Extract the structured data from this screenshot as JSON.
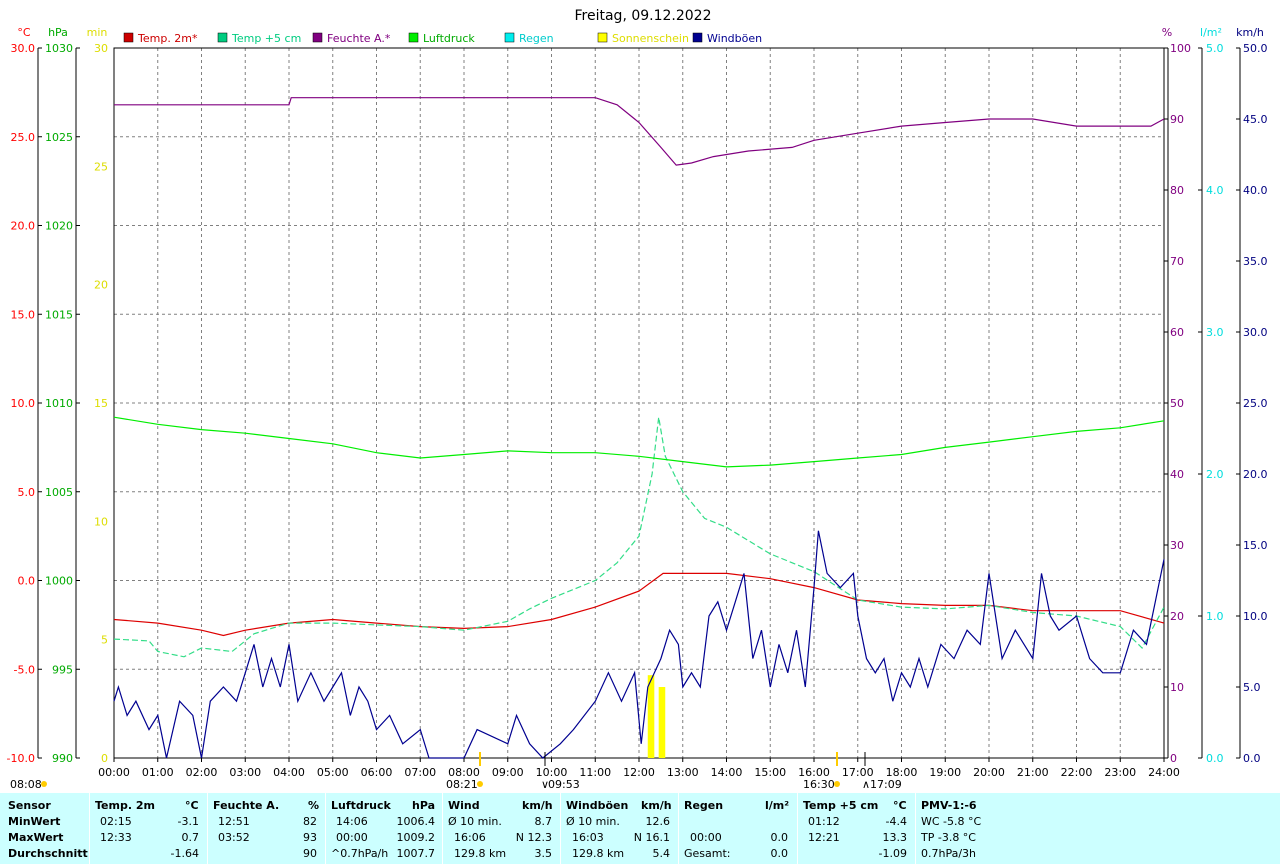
{
  "chart_data": {
    "type": "line",
    "title": "Freitag, 09.12.2022",
    "x_ticks": [
      "00:00",
      "01:00",
      "02:00",
      "03:00",
      "04:00",
      "05:00",
      "06:00",
      "07:00",
      "08:00",
      "09:00",
      "10:00",
      "11:00",
      "12:00",
      "13:00",
      "14:00",
      "15:00",
      "16:00",
      "17:00",
      "18:00",
      "19:00",
      "20:00",
      "21:00",
      "22:00",
      "23:00",
      "24:00"
    ],
    "axes": {
      "temp": {
        "unit": "°C",
        "range": [
          -10,
          30
        ],
        "ticks": [
          "30.0",
          "25.0",
          "20.0",
          "15.0",
          "10.0",
          "5.0",
          "0.0",
          "-5.0",
          "-10.0"
        ],
        "color": "#ff0000"
      },
      "pressure": {
        "unit": "hPa",
        "range": [
          990,
          1030
        ],
        "ticks": [
          "1030",
          "1025",
          "1020",
          "1015",
          "1010",
          "1005",
          "1000",
          "995",
          "990"
        ],
        "color": "#00aa00"
      },
      "sunshine": {
        "unit": "min",
        "range": [
          0,
          30
        ],
        "ticks": [
          "30",
          "25",
          "20",
          "15",
          "10",
          "5",
          "0"
        ],
        "color": "#dddd00"
      },
      "humidity": {
        "unit": "%",
        "range": [
          0,
          100
        ],
        "ticks": [
          "100",
          "90",
          "80",
          "70",
          "60",
          "50",
          "40",
          "30",
          "20",
          "10",
          "0"
        ],
        "color": "#800080"
      },
      "rain": {
        "unit": "l/m²",
        "range": [
          0,
          5
        ],
        "ticks": [
          "5.0",
          "4.0",
          "3.0",
          "2.0",
          "1.0",
          "0.0"
        ],
        "color": "#00dddd"
      },
      "wind": {
        "unit": "km/h",
        "range": [
          0,
          50
        ],
        "ticks": [
          "50.0",
          "45.0",
          "40.0",
          "35.0",
          "30.0",
          "25.0",
          "20.0",
          "15.0",
          "10.0",
          "5.0",
          "0.0"
        ],
        "color": "#000080"
      }
    },
    "legend": [
      {
        "name": "Temp. 2m*",
        "color": "#cc0000"
      },
      {
        "name": "Temp +5 cm",
        "color": "#00cc80"
      },
      {
        "name": "Feuchte A.*",
        "color": "#800080"
      },
      {
        "name": "Luftdruck",
        "color": "#00ee00"
      },
      {
        "name": "Regen",
        "color": "#00eeee"
      },
      {
        "name": "Sonnenschein",
        "color": "#ffff00"
      },
      {
        "name": "Windböen",
        "color": "#000090"
      }
    ],
    "series": [
      {
        "name": "Temp. 2m*",
        "axis": "temp",
        "color": "#dd0000",
        "points": [
          [
            0,
            -2.2
          ],
          [
            1,
            -2.4
          ],
          [
            2,
            -2.8
          ],
          [
            2.5,
            -3.1
          ],
          [
            3,
            -2.8
          ],
          [
            4,
            -2.4
          ],
          [
            5,
            -2.2
          ],
          [
            6,
            -2.4
          ],
          [
            7,
            -2.6
          ],
          [
            8,
            -2.7
          ],
          [
            9,
            -2.6
          ],
          [
            10,
            -2.2
          ],
          [
            11,
            -1.5
          ],
          [
            12,
            -0.6
          ],
          [
            12.55,
            0.4
          ],
          [
            13,
            0.4
          ],
          [
            14,
            0.4
          ],
          [
            15,
            0.1
          ],
          [
            16,
            -0.4
          ],
          [
            17,
            -1.1
          ],
          [
            18,
            -1.3
          ],
          [
            19,
            -1.4
          ],
          [
            20,
            -1.4
          ],
          [
            21,
            -1.7
          ],
          [
            22,
            -1.7
          ],
          [
            23,
            -1.7
          ],
          [
            24,
            -2.4
          ]
        ]
      },
      {
        "name": "Temp +5 cm",
        "axis": "temp",
        "color": "#33dd88",
        "points": [
          [
            0,
            -3.3
          ],
          [
            0.8,
            -3.4
          ],
          [
            1,
            -4.0
          ],
          [
            1.6,
            -4.3
          ],
          [
            2,
            -3.8
          ],
          [
            2.7,
            -4.0
          ],
          [
            3.2,
            -3.0
          ],
          [
            4,
            -2.4
          ],
          [
            5,
            -2.4
          ],
          [
            6,
            -2.5
          ],
          [
            7,
            -2.6
          ],
          [
            8,
            -2.8
          ],
          [
            9,
            -2.3
          ],
          [
            9.5,
            -1.6
          ],
          [
            10,
            -1.0
          ],
          [
            11,
            0.0
          ],
          [
            11.5,
            1.0
          ],
          [
            12,
            2.5
          ],
          [
            12.3,
            6.0
          ],
          [
            12.45,
            9.2
          ],
          [
            12.6,
            7.0
          ],
          [
            13,
            5.0
          ],
          [
            13.5,
            3.5
          ],
          [
            14,
            3.0
          ],
          [
            15,
            1.5
          ],
          [
            16,
            0.5
          ],
          [
            17,
            -1.1
          ],
          [
            18,
            -1.5
          ],
          [
            19,
            -1.6
          ],
          [
            20,
            -1.4
          ],
          [
            21,
            -1.8
          ],
          [
            22,
            -2.0
          ],
          [
            23,
            -2.6
          ],
          [
            23.5,
            -3.8
          ],
          [
            24,
            -1.5
          ]
        ]
      },
      {
        "name": "Feuchte A.*",
        "axis": "humidity",
        "color": "#800080",
        "points": [
          [
            0,
            92.0
          ],
          [
            4,
            92.0
          ],
          [
            4.05,
            93.0
          ],
          [
            11,
            93.0
          ],
          [
            11.5,
            92.0
          ],
          [
            12,
            89.5
          ],
          [
            12.5,
            86.0
          ],
          [
            12.85,
            83.5
          ],
          [
            13.2,
            83.8
          ],
          [
            13.7,
            84.7
          ],
          [
            14.5,
            85.5
          ],
          [
            15.5,
            86.0
          ],
          [
            16,
            87.0
          ],
          [
            17,
            88.0
          ],
          [
            18,
            89.0
          ],
          [
            19,
            89.5
          ],
          [
            20,
            90.0
          ],
          [
            21,
            90.0
          ],
          [
            22,
            89.0
          ],
          [
            23,
            89.0
          ],
          [
            23.7,
            89.0
          ],
          [
            24,
            90.0
          ]
        ]
      },
      {
        "name": "Luftdruck",
        "axis": "pressure",
        "color": "#00ee00",
        "points": [
          [
            0,
            1009.2
          ],
          [
            1,
            1008.8
          ],
          [
            2,
            1008.5
          ],
          [
            3,
            1008.3
          ],
          [
            4,
            1008.0
          ],
          [
            5,
            1007.7
          ],
          [
            6,
            1007.2
          ],
          [
            7,
            1006.9
          ],
          [
            8,
            1007.1
          ],
          [
            9,
            1007.3
          ],
          [
            10,
            1007.2
          ],
          [
            11,
            1007.2
          ],
          [
            12,
            1007.0
          ],
          [
            13,
            1006.7
          ],
          [
            14,
            1006.4
          ],
          [
            15,
            1006.5
          ],
          [
            16,
            1006.7
          ],
          [
            17,
            1006.9
          ],
          [
            18,
            1007.1
          ],
          [
            19,
            1007.5
          ],
          [
            20,
            1007.8
          ],
          [
            21,
            1008.1
          ],
          [
            22,
            1008.4
          ],
          [
            23,
            1008.6
          ],
          [
            24,
            1009.0
          ]
        ]
      },
      {
        "name": "Windböen",
        "axis": "wind",
        "color": "#000090",
        "points": [
          [
            0,
            4
          ],
          [
            0.1,
            5
          ],
          [
            0.3,
            3
          ],
          [
            0.5,
            4
          ],
          [
            0.8,
            2
          ],
          [
            1,
            3
          ],
          [
            1.2,
            0
          ],
          [
            1.5,
            4
          ],
          [
            1.8,
            3
          ],
          [
            2,
            0
          ],
          [
            2.2,
            4
          ],
          [
            2.5,
            5
          ],
          [
            2.8,
            4
          ],
          [
            3,
            6
          ],
          [
            3.2,
            8
          ],
          [
            3.4,
            5
          ],
          [
            3.6,
            7
          ],
          [
            3.8,
            5
          ],
          [
            4,
            8
          ],
          [
            4.2,
            4
          ],
          [
            4.5,
            6
          ],
          [
            4.8,
            4
          ],
          [
            5,
            5
          ],
          [
            5.2,
            6
          ],
          [
            5.4,
            3
          ],
          [
            5.6,
            5
          ],
          [
            5.8,
            4
          ],
          [
            6,
            2
          ],
          [
            6.3,
            3
          ],
          [
            6.6,
            1
          ],
          [
            7,
            2
          ],
          [
            7.2,
            0
          ],
          [
            8,
            0
          ],
          [
            8.3,
            2
          ],
          [
            9,
            1
          ],
          [
            9.2,
            3
          ],
          [
            9.5,
            1
          ],
          [
            9.8,
            0
          ],
          [
            10.2,
            1
          ],
          [
            10.5,
            2
          ],
          [
            11,
            4
          ],
          [
            11.3,
            6
          ],
          [
            11.6,
            4
          ],
          [
            11.9,
            6
          ],
          [
            12.05,
            1
          ],
          [
            12.2,
            5
          ],
          [
            12.5,
            7
          ],
          [
            12.7,
            9
          ],
          [
            12.9,
            8
          ],
          [
            13,
            5
          ],
          [
            13.2,
            6
          ],
          [
            13.4,
            5
          ],
          [
            13.6,
            10
          ],
          [
            13.8,
            11
          ],
          [
            14,
            9
          ],
          [
            14.2,
            11
          ],
          [
            14.4,
            13
          ],
          [
            14.6,
            7
          ],
          [
            14.8,
            9
          ],
          [
            15,
            5
          ],
          [
            15.2,
            8
          ],
          [
            15.4,
            6
          ],
          [
            15.6,
            9
          ],
          [
            15.8,
            5
          ],
          [
            16,
            12
          ],
          [
            16.1,
            16
          ],
          [
            16.3,
            13
          ],
          [
            16.6,
            12
          ],
          [
            16.9,
            13
          ],
          [
            17,
            10
          ],
          [
            17.2,
            7
          ],
          [
            17.4,
            6
          ],
          [
            17.6,
            7
          ],
          [
            17.8,
            4
          ],
          [
            18,
            6
          ],
          [
            18.2,
            5
          ],
          [
            18.4,
            7
          ],
          [
            18.6,
            5
          ],
          [
            18.9,
            8
          ],
          [
            19.2,
            7
          ],
          [
            19.5,
            9
          ],
          [
            19.8,
            8
          ],
          [
            20,
            13
          ],
          [
            20.3,
            7
          ],
          [
            20.6,
            9
          ],
          [
            21,
            7
          ],
          [
            21.2,
            13
          ],
          [
            21.4,
            10
          ],
          [
            21.6,
            9
          ],
          [
            22,
            10
          ],
          [
            22.3,
            7
          ],
          [
            22.6,
            6
          ],
          [
            23,
            6
          ],
          [
            23.3,
            9
          ],
          [
            23.6,
            8
          ],
          [
            23.8,
            11
          ],
          [
            24,
            14
          ]
        ]
      }
    ],
    "sunshine_bars": [
      [
        12.2,
        12.35,
        3.5
      ],
      [
        12.45,
        12.6,
        3.0
      ]
    ],
    "time_markers": {
      "sunrise": "08:08",
      "sunset": "16:30",
      "rain_start": "08:21",
      "rain_end": "17:09",
      "sun_max": "09:53"
    }
  },
  "stats": {
    "headers": {
      "sensor": "Sensor",
      "temp2m": "Temp. 2m",
      "temp2m_unit": "°C",
      "feuchte": "Feuchte A.",
      "feuchte_unit": "%",
      "luftdruck": "Luftdruck",
      "luftdruck_unit": "hPa",
      "wind": "Wind",
      "wind_unit": "km/h",
      "windboeen": "Windböen",
      "windboeen_unit": "km/h",
      "regen": "Regen",
      "regen_unit": "l/m²",
      "temp5cm": "Temp +5 cm",
      "temp5cm_unit": "°C",
      "pmv": "PMV-1:-6"
    },
    "rows": {
      "min_label": "MinWert",
      "max_label": "MaxWert",
      "avg_label": "Durchschnitt"
    },
    "temp2m": {
      "min_time": "02:15",
      "min": "-3.1",
      "max_time": "12:33",
      "max": "0.7",
      "avg": "-1.64"
    },
    "feuchte": {
      "min_time": "12:51",
      "min": "82",
      "max_time": "03:52",
      "max": "93",
      "avg": "90"
    },
    "luftdruck": {
      "min_time": "14:06",
      "min": "1006.4",
      "max_time": "00:00",
      "max": "1009.2",
      "trend": "^0.7hPa/h",
      "avg": "1007.7"
    },
    "wind": {
      "r1_label": "Ø 10 min.",
      "r1": "8.7",
      "r2_time": "16:06",
      "r2": "N 12.3",
      "r3_label": "129.8 km",
      "r3": "3.5"
    },
    "windboeen": {
      "r1_label": "Ø 10 min.",
      "r1": "12.6",
      "r2_time": "16:03",
      "r2": "N 16.1",
      "r3_label": "129.8 km",
      "r3": "5.4"
    },
    "regen": {
      "r2_time": "00:00",
      "r2": "0.0",
      "r3_label": "Gesamt:",
      "r3": "0.0"
    },
    "temp5cm": {
      "min_time": "01:12",
      "min": "-4.4",
      "max_time": "12:21",
      "max": "13.3",
      "avg": "-1.09"
    },
    "pmv": {
      "r1": "WC -5.8 °C",
      "r2": "TP -3.8 °C",
      "r3": "0.7hPa/3h"
    }
  }
}
